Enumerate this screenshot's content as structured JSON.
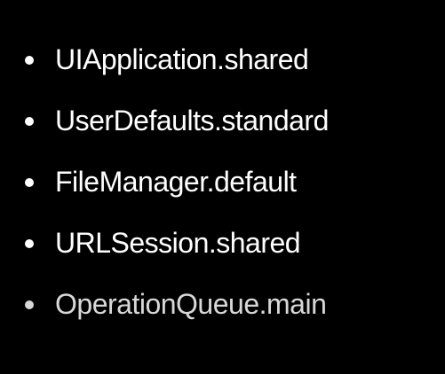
{
  "slide": {
    "bullets": [
      {
        "text": "UIApplication.shared"
      },
      {
        "text": "UserDefaults.standard"
      },
      {
        "text": "FileManager.default"
      },
      {
        "text": "URLSession.shared"
      },
      {
        "text": "OperationQueue.main"
      }
    ],
    "colors": {
      "background": "#000000",
      "text": "#ffffff",
      "text_dim": "#d8d8d8"
    }
  }
}
